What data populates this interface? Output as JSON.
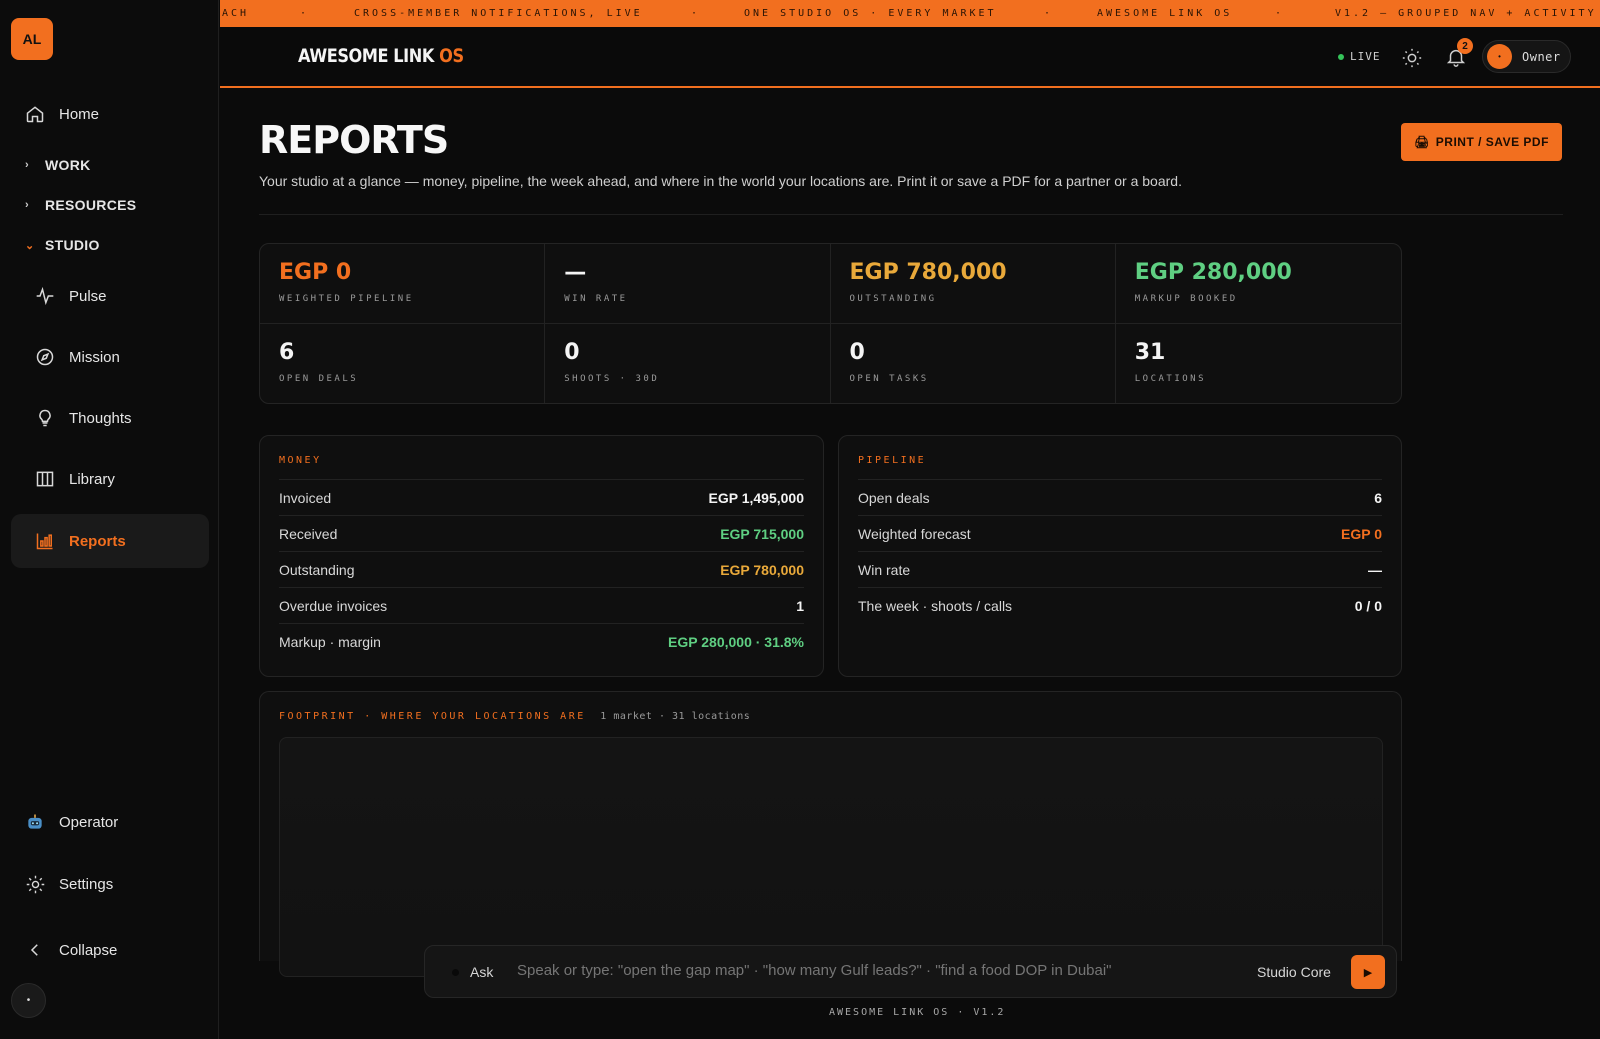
{
  "sidebar": {
    "logo_text": "AL",
    "home_label": "Home",
    "groups": [
      {
        "label": "WORK",
        "open": false
      },
      {
        "label": "RESOURCES",
        "open": false
      },
      {
        "label": "STUDIO",
        "open": true
      }
    ],
    "items": [
      {
        "label": "Pulse",
        "icon": "pulse-icon"
      },
      {
        "label": "Mission",
        "icon": "compass-icon"
      },
      {
        "label": "Thoughts",
        "icon": "lightbulb-icon"
      },
      {
        "label": "Library",
        "icon": "columns-icon"
      },
      {
        "label": "Reports",
        "icon": "bar-chart-icon",
        "active": true
      }
    ],
    "operator_label": "Operator",
    "settings_label": "Settings",
    "collapse_label": "Collapse",
    "user_initial": "•"
  },
  "ticker": {
    "segments": [
      "ACH",
      "·",
      "CROSS-MEMBER NOTIFICATIONS, LIVE",
      "·",
      "ONE STUDIO OS · EVERY MARKET",
      "·",
      "AWESOME LINK OS",
      "·",
      "V1.2 — GROUPED NAV + ACTIVITY"
    ]
  },
  "header": {
    "brand": "AWESOME LINK",
    "brand_accent": "OS",
    "live_label": "LIVE",
    "notifications_count": "2",
    "owner_label": "Owner",
    "owner_initial": "•"
  },
  "page": {
    "title": "REPORTS",
    "subtitle": "Your studio at a glance — money, pipeline, the week ahead, and where in the world your locations are. Print it or save a PDF for a partner or a board.",
    "print_label": "PRINT / SAVE PDF"
  },
  "kpis": [
    {
      "value": "EGP 0",
      "label": "WEIGHTED PIPELINE",
      "color": "#f26f1f"
    },
    {
      "value": "—",
      "label": "WIN RATE",
      "color": "#f4f4f4"
    },
    {
      "value": "EGP 780,000",
      "label": "OUTSTANDING",
      "color": "#e9a93a"
    },
    {
      "value": "EGP 280,000",
      "label": "MARKUP BOOKED",
      "color": "#5fcf82"
    },
    {
      "value": "6",
      "label": "OPEN DEALS",
      "color": "#f4f4f4"
    },
    {
      "value": "0",
      "label": "SHOOTS · 30D",
      "color": "#f4f4f4"
    },
    {
      "value": "0",
      "label": "OPEN TASKS",
      "color": "#f4f4f4"
    },
    {
      "value": "31",
      "label": "LOCATIONS",
      "color": "#f4f4f4"
    }
  ],
  "money": {
    "heading": "MONEY",
    "rows": [
      {
        "label": "Invoiced",
        "value": "EGP 1,495,000",
        "color": "#f4f4f4"
      },
      {
        "label": "Received",
        "value": "EGP 715,000",
        "color": "#5fcf82"
      },
      {
        "label": "Outstanding",
        "value": "EGP 780,000",
        "color": "#e9a93a"
      },
      {
        "label": "Overdue invoices",
        "value": "1",
        "color": "#f4f4f4"
      },
      {
        "label": "Markup · margin",
        "value": "EGP 280,000 · 31.8%",
        "color": "#5fcf82"
      }
    ]
  },
  "pipeline": {
    "heading": "PIPELINE",
    "rows": [
      {
        "label": "Open deals",
        "value": "6",
        "color": "#f4f4f4"
      },
      {
        "label": "Weighted forecast",
        "value": "EGP 0",
        "color": "#f26f1f"
      },
      {
        "label": "Win rate",
        "value": "—",
        "color": "#f4f4f4"
      },
      {
        "label": "The week · shoots / calls",
        "value": "0 / 0",
        "color": "#f4f4f4"
      }
    ]
  },
  "footprint": {
    "heading": "FOOTPRINT · WHERE YOUR LOCATIONS ARE",
    "meta": "1 market · 31 locations"
  },
  "ask": {
    "label": "Ask",
    "placeholder": "Speak or type: \"open the gap map\" · \"how many Gulf leads?\" · \"find a food DOP in Dubai\"",
    "model": "Studio Core"
  },
  "footer": {
    "version": "AWESOME LINK OS · V1.2"
  },
  "colors": {
    "accent": "#f26f1f",
    "amber": "#e9a93a",
    "green": "#5fcf82",
    "background": "#0b0b0b"
  }
}
